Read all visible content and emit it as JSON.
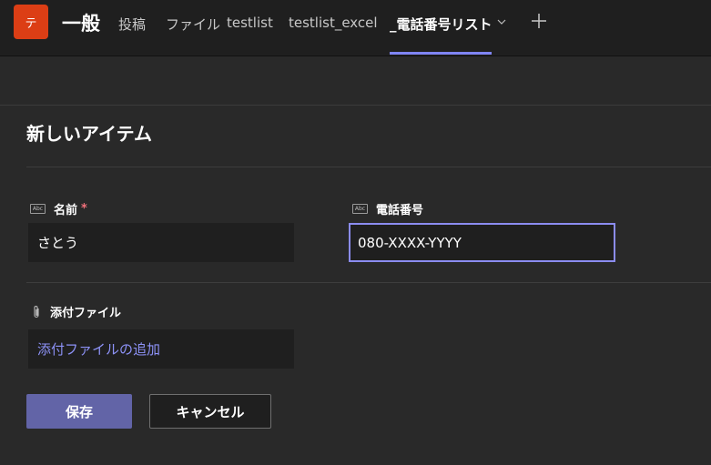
{
  "header": {
    "team_avatar_letter": "テ",
    "channel_name": "一般",
    "tabs": [
      {
        "label": "投稿"
      },
      {
        "label": "ファイル"
      },
      {
        "label": "testlist"
      },
      {
        "label": "testlist_excel"
      },
      {
        "label": "_電話番号リスト"
      }
    ],
    "active_tab": "_電話番号リスト",
    "accent_color": "#7f85f5",
    "avatar_color": "#dc3e15"
  },
  "form": {
    "title": "新しいアイテム",
    "fields": [
      {
        "type_icon": "Abc",
        "label": "名前",
        "required_mark": "*",
        "value": "さとう"
      },
      {
        "type_icon": "Abc",
        "label": "電話番号",
        "value": "080-XXXX-YYYY"
      }
    ],
    "attachments": {
      "label": "添付ファイル",
      "link": "添付ファイルの追加"
    },
    "buttons": {
      "save": "保存",
      "cancel": "キャンセル"
    }
  },
  "icons": {
    "tab_dropdown": "chevron-down-icon",
    "add_tab": "plus-icon",
    "text_field": "abc-text-field-icon",
    "attachment": "paperclip-icon"
  }
}
